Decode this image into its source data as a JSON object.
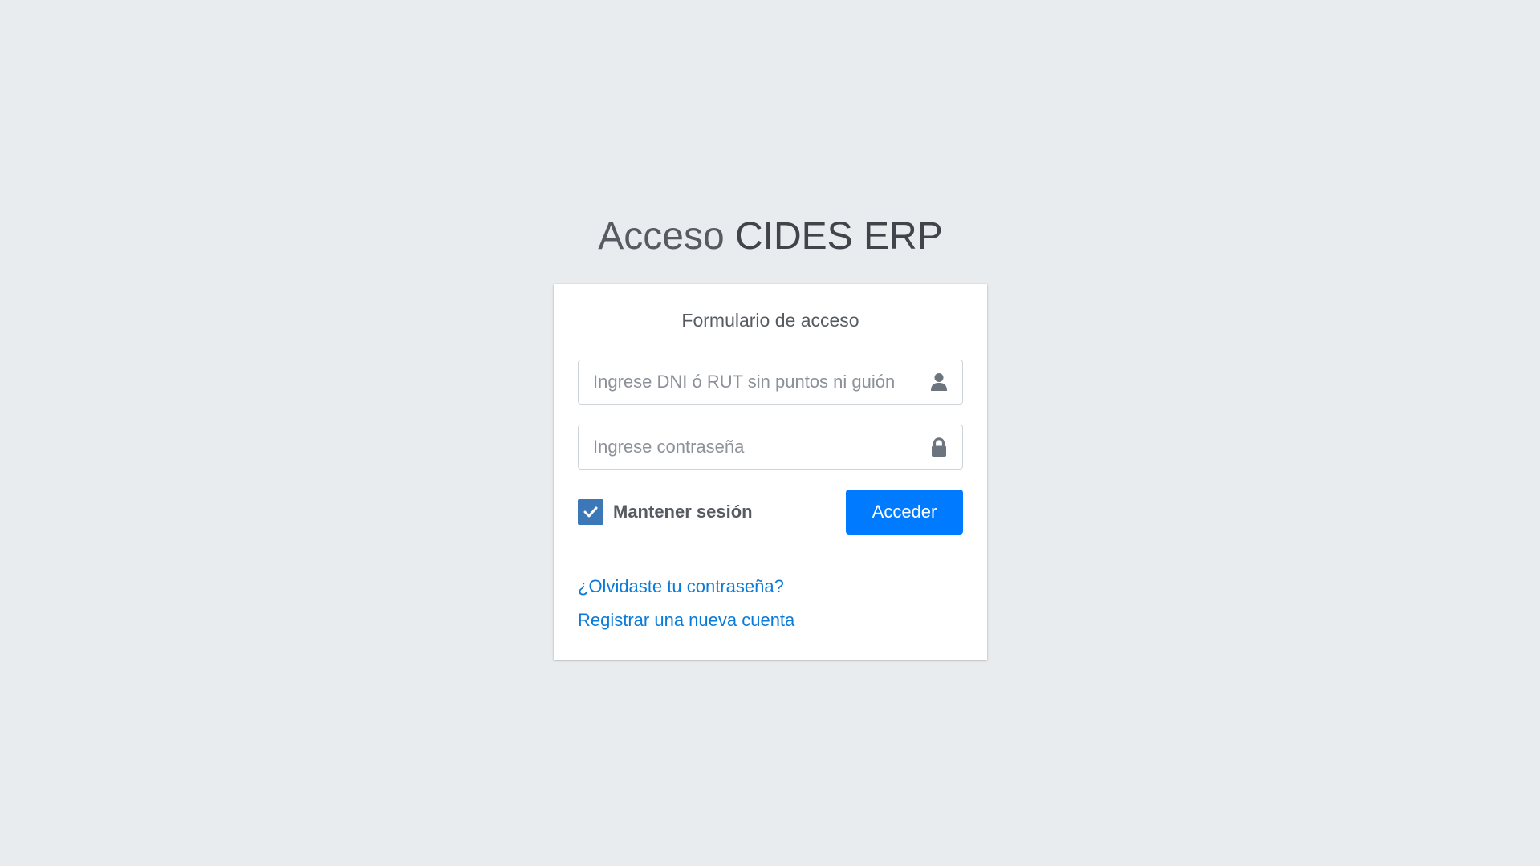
{
  "page": {
    "title_light": "Acceso",
    "title_bold": "CIDES ERP"
  },
  "form": {
    "heading": "Formulario de acceso",
    "username_placeholder": "Ingrese DNI ó RUT sin puntos ni guión",
    "username_value": "",
    "password_placeholder": "Ingrese contraseña",
    "password_value": "",
    "remember_label": "Mantener sesión",
    "remember_checked": true,
    "submit_label": "Acceder"
  },
  "links": {
    "forgot_password": "¿Olvidaste tu contraseña?",
    "register": "Registrar una nueva cuenta"
  },
  "icons": {
    "username": "user-icon",
    "password": "lock-icon",
    "checkbox": "check-icon"
  },
  "colors": {
    "background": "#e9ecef",
    "primary": "#007bff",
    "checkbox": "#3c78b8",
    "link": "#0a7bd8"
  }
}
